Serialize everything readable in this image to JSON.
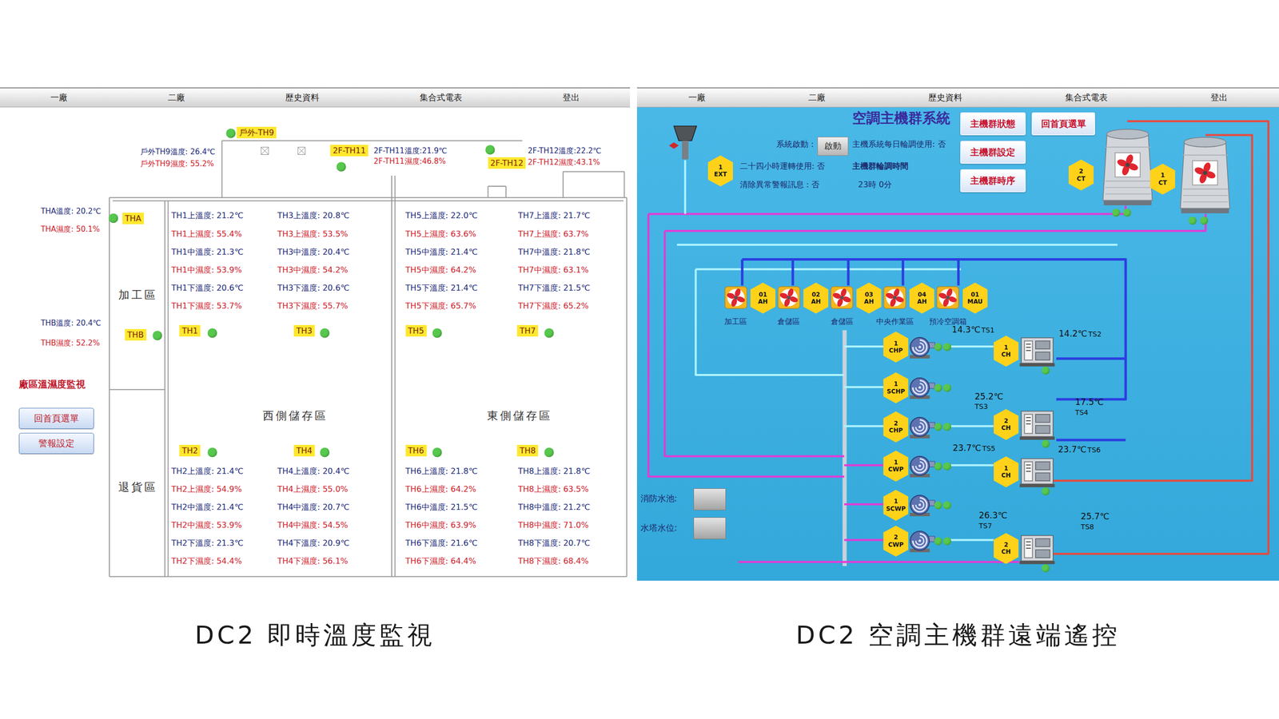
{
  "left_screen": {
    "menu": [
      "一廠",
      "二廠",
      "歷史資料",
      "集合式電表",
      "登出"
    ],
    "sensors": [
      {
        "label": "戶外-TH9",
        "online": true,
        "readings": [
          {
            "text": "戶外TH9溫度: 26.4℃",
            "kind": "temp"
          },
          {
            "text": "戶外TH9濕度: 55.2%",
            "kind": "humidity"
          }
        ]
      },
      {
        "label": "2F-TH11",
        "online": true,
        "readings": [
          {
            "text": "2F-TH11溫度:21.9℃",
            "kind": "temp"
          },
          {
            "text": "2F-TH11濕度:46.8%",
            "kind": "humidity"
          }
        ]
      },
      {
        "label": "2F-TH12",
        "online": true,
        "readings": [
          {
            "text": "2F-TH12溫度:22.2℃",
            "kind": "temp"
          },
          {
            "text": "2F-TH12濕度:43.1%",
            "kind": "humidity"
          }
        ]
      },
      {
        "label": "THA",
        "online": true,
        "readings": [
          {
            "text": "THA溫度: 20.2℃",
            "kind": "temp"
          },
          {
            "text": "THA濕度: 50.1%",
            "kind": "humidity"
          }
        ]
      },
      {
        "label": "THB",
        "online": true,
        "readings": [
          {
            "text": "THB溫度: 20.4℃",
            "kind": "temp"
          },
          {
            "text": "THB濕度: 52.2%",
            "kind": "humidity"
          }
        ]
      },
      {
        "label": "TH1",
        "online": true,
        "readings": [
          {
            "text": "TH1上溫度: 21.2℃",
            "kind": "temp"
          },
          {
            "text": "TH1上濕度: 55.4%",
            "kind": "humidity"
          },
          {
            "text": "TH1中溫度: 21.3℃",
            "kind": "temp"
          },
          {
            "text": "TH1中濕度: 53.9%",
            "kind": "humidity"
          },
          {
            "text": "TH1下溫度: 20.6℃",
            "kind": "temp"
          },
          {
            "text": "TH1下濕度: 53.7%",
            "kind": "humidity"
          }
        ]
      },
      {
        "label": "TH3",
        "online": true,
        "readings": [
          {
            "text": "TH3上溫度: 20.8℃",
            "kind": "temp"
          },
          {
            "text": "TH3上濕度: 53.5%",
            "kind": "humidity"
          },
          {
            "text": "TH3中溫度: 20.4℃",
            "kind": "temp"
          },
          {
            "text": "TH3中濕度: 54.2%",
            "kind": "humidity"
          },
          {
            "text": "TH3下溫度: 20.6℃",
            "kind": "temp"
          },
          {
            "text": "TH3下濕度: 55.7%",
            "kind": "humidity"
          }
        ]
      },
      {
        "label": "TH5",
        "online": true,
        "readings": [
          {
            "text": "TH5上溫度: 22.0℃",
            "kind": "temp"
          },
          {
            "text": "TH5上濕度: 63.6%",
            "kind": "humidity"
          },
          {
            "text": "TH5中溫度: 21.4℃",
            "kind": "temp"
          },
          {
            "text": "TH5中濕度: 64.2%",
            "kind": "humidity"
          },
          {
            "text": "TH5下溫度: 21.4℃",
            "kind": "temp"
          },
          {
            "text": "TH5下濕度: 65.7%",
            "kind": "humidity"
          }
        ]
      },
      {
        "label": "TH7",
        "online": true,
        "readings": [
          {
            "text": "TH7上溫度: 21.7℃",
            "kind": "temp"
          },
          {
            "text": "TH7上濕度: 63.7%",
            "kind": "humidity"
          },
          {
            "text": "TH7中溫度: 21.8℃",
            "kind": "temp"
          },
          {
            "text": "TH7中濕度: 63.1%",
            "kind": "humidity"
          },
          {
            "text": "TH7下溫度: 21.5℃",
            "kind": "temp"
          },
          {
            "text": "TH7下濕度: 65.2%",
            "kind": "humidity"
          }
        ]
      },
      {
        "label": "TH2",
        "online": true,
        "readings": [
          {
            "text": "TH2上溫度: 21.4℃",
            "kind": "temp"
          },
          {
            "text": "TH2上濕度: 54.9%",
            "kind": "humidity"
          },
          {
            "text": "TH2中溫度: 21.4℃",
            "kind": "temp"
          },
          {
            "text": "TH2中濕度: 53.9%",
            "kind": "humidity"
          },
          {
            "text": "TH2下溫度: 21.3℃",
            "kind": "temp"
          },
          {
            "text": "TH2下濕度: 54.4%",
            "kind": "humidity"
          }
        ]
      },
      {
        "label": "TH4",
        "online": true,
        "readings": [
          {
            "text": "TH4上溫度: 20.4℃",
            "kind": "temp"
          },
          {
            "text": "TH4上濕度: 55.0%",
            "kind": "humidity"
          },
          {
            "text": "TH4中溫度: 20.7℃",
            "kind": "temp"
          },
          {
            "text": "TH4中濕度: 54.5%",
            "kind": "humidity"
          },
          {
            "text": "TH4下溫度: 20.9℃",
            "kind": "temp"
          },
          {
            "text": "TH4下濕度: 56.1%",
            "kind": "humidity"
          }
        ]
      },
      {
        "label": "TH6",
        "online": true,
        "readings": [
          {
            "text": "TH6上溫度: 21.8℃",
            "kind": "temp"
          },
          {
            "text": "TH6上濕度: 64.2%",
            "kind": "humidity"
          },
          {
            "text": "TH6中溫度: 21.5℃",
            "kind": "temp"
          },
          {
            "text": "TH6中濕度: 63.9%",
            "kind": "humidity"
          },
          {
            "text": "TH6下溫度: 21.6℃",
            "kind": "temp"
          },
          {
            "text": "TH6下濕度: 64.4%",
            "kind": "humidity"
          }
        ]
      },
      {
        "label": "TH8",
        "online": true,
        "readings": [
          {
            "text": "TH8上溫度: 21.8℃",
            "kind": "temp"
          },
          {
            "text": "TH8上濕度: 63.5%",
            "kind": "humidity"
          },
          {
            "text": "TH8中溫度: 21.2℃",
            "kind": "temp"
          },
          {
            "text": "TH8中濕度: 71.0%",
            "kind": "humidity"
          },
          {
            "text": "TH8下溫度: 20.7℃",
            "kind": "temp"
          },
          {
            "text": "TH8下濕度: 68.4%",
            "kind": "humidity"
          }
        ]
      }
    ],
    "zones": [
      "加工區",
      "退貨區",
      "西側儲存區",
      "東側儲存區"
    ],
    "side_title": "廠區溫濕度監視",
    "side_buttons": [
      "回首頁選單",
      "警報設定"
    ]
  },
  "right_screen": {
    "menu": [
      "一廠",
      "二廠",
      "歷史資料",
      "集合式電表",
      "登出"
    ],
    "title": "空調主機群系統",
    "nav_buttons": [
      "主機群狀態",
      "回首頁選單",
      "主機群設定",
      "主機群時序"
    ],
    "start_label": "系統啟動 :",
    "start_button": "啟動",
    "settings": [
      "主機系統每日輪調使用: 否",
      "二十四小時運轉使用: 否",
      "清除異常警報訊息 : 否"
    ],
    "rotation_title": "主機群輪調時間",
    "rotation_time": "23時 0分",
    "exhaust": {
      "number": "1",
      "type": "EXT"
    },
    "towers": [
      {
        "number": "2",
        "type": "CT",
        "online": true
      },
      {
        "number": "1",
        "type": "CT",
        "online": true
      }
    ],
    "air_handlers": [
      {
        "number": "01",
        "type": "AH",
        "label": "加工區"
      },
      {
        "number": "02",
        "type": "AH",
        "label": "倉儲區"
      },
      {
        "number": "03",
        "type": "AH",
        "label": "倉儲區"
      },
      {
        "number": "04",
        "type": "AH",
        "label": "中央作業區"
      },
      {
        "number": "01",
        "type": "MAU",
        "label": "預冷空調箱"
      }
    ],
    "pumps": [
      {
        "number": "1",
        "type": "CHP",
        "online": true
      },
      {
        "number": "1",
        "type": "SCHP",
        "online": true
      },
      {
        "number": "2",
        "type": "CHP",
        "online": true
      },
      {
        "number": "1",
        "type": "CWP",
        "online": true
      },
      {
        "number": "1",
        "type": "SCWP",
        "online": true
      },
      {
        "number": "2",
        "type": "CWP",
        "online": true
      }
    ],
    "chillers": [
      {
        "number": "1",
        "type": "CH",
        "online": true,
        "sensors": [
          {
            "name": "TS1",
            "value": "14.3℃"
          },
          {
            "name": "TS2",
            "value": "14.2℃"
          }
        ]
      },
      {
        "number": "2",
        "type": "CH",
        "online": true,
        "sensors": [
          {
            "name": "TS3",
            "value": "25.2℃"
          },
          {
            "name": "TS4",
            "value": "17.5℃"
          }
        ]
      },
      {
        "number": "1",
        "type": "CH",
        "online": true,
        "sensors": [
          {
            "name": "TS5",
            "value": "23.7℃"
          },
          {
            "name": "TS6",
            "value": "23.7℃"
          }
        ]
      },
      {
        "number": "2",
        "type": "CH",
        "online": true,
        "sensors": [
          {
            "name": "TS7",
            "value": "26.3℃"
          },
          {
            "name": "TS8",
            "value": "25.7℃"
          }
        ]
      }
    ],
    "water_levels": [
      {
        "label": "消防水池:"
      },
      {
        "label": "水塔水位:"
      }
    ]
  },
  "captions": [
    "DC2 即時溫度監視",
    "DC2 空調主機群遠端遙控"
  ]
}
